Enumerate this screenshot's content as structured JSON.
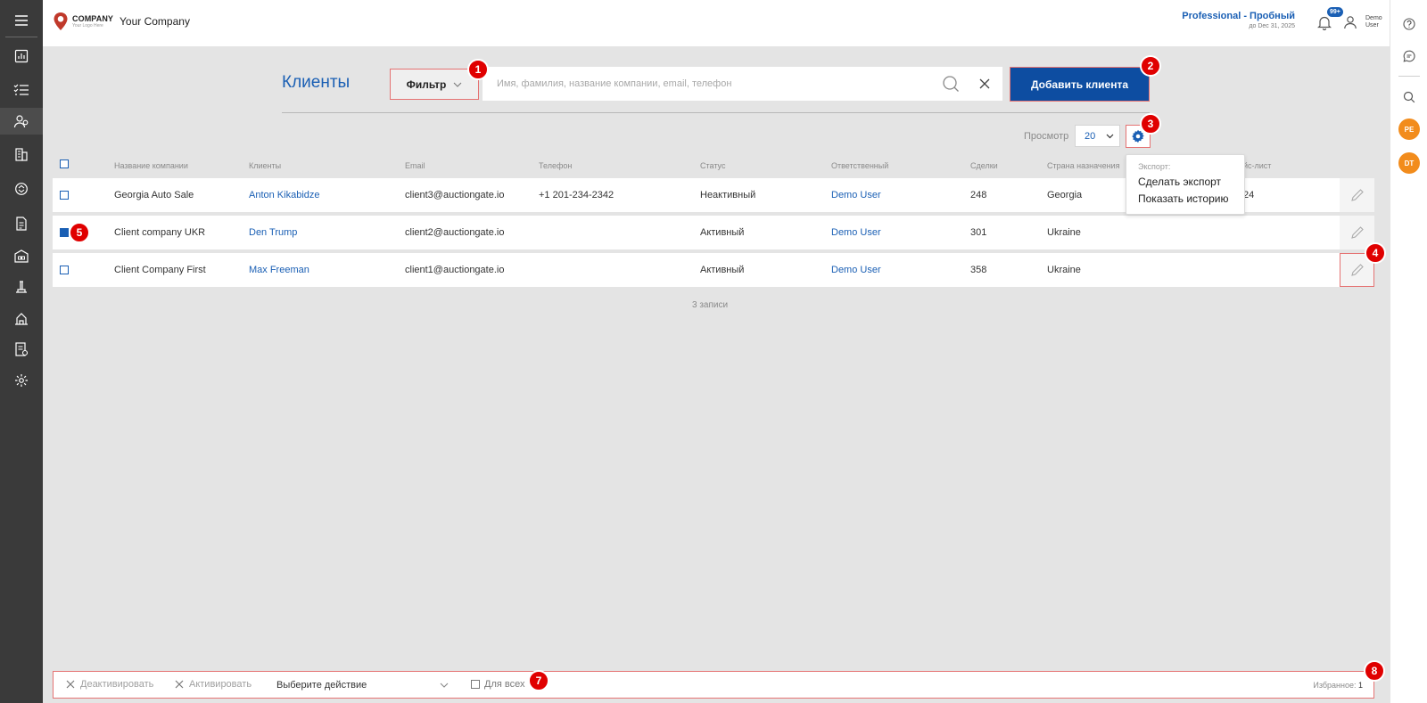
{
  "header": {
    "logo_main": "COMPANY",
    "logo_sub": "Your Logo Here",
    "company_name": "Your Company",
    "plan_title": "Professional - Пробный",
    "plan_date": "до Dec 31, 2025",
    "notifications_badge": "99+",
    "user_name": "Demo User"
  },
  "sidebar": {
    "items": [
      {
        "icon": "menu-icon"
      },
      {
        "icon": "dashboard-icon"
      },
      {
        "icon": "tasks-list-icon"
      },
      {
        "icon": "clients-icon",
        "active": true
      },
      {
        "icon": "buildings-icon"
      },
      {
        "icon": "exchange-icon"
      },
      {
        "icon": "document-icon"
      },
      {
        "icon": "warehouse-icon"
      },
      {
        "icon": "auction-icon"
      },
      {
        "icon": "port-icon"
      },
      {
        "icon": "invoice-icon"
      },
      {
        "icon": "settings-icon"
      }
    ]
  },
  "right_rail": {
    "avatars": [
      "PE",
      "DT"
    ]
  },
  "toolbar": {
    "page_title": "Клиенты",
    "filter_label": "Фильтр",
    "search_placeholder": "Имя, фамилия, название компании, email, телефон",
    "add_client_label": "Добавить клиента",
    "view_label": "Просмотр",
    "page_size": "20"
  },
  "export_menu": {
    "title": "Экспорт:",
    "items": [
      "Сделать экспорт",
      "Показать историю"
    ]
  },
  "table": {
    "columns": [
      "Название компании",
      "Клиенты",
      "Email",
      "Телефон",
      "Статус",
      "Ответственный",
      "Сделки",
      "Страна назначения",
      "йс-лист"
    ],
    "rows": [
      {
        "company": "Georgia Auto Sale",
        "client": "Anton Kikabidze",
        "email": "client3@auctiongate.io",
        "phone": "+1 201-234-2342",
        "status": "Неактивный",
        "manager": "Demo User",
        "deals": "248",
        "country": "Georgia",
        "price_list": "24",
        "checked": false
      },
      {
        "company": "Client company UKR",
        "client": "Den Trump",
        "email": "client2@auctiongate.io",
        "phone": "",
        "status": "Активный",
        "manager": "Demo User",
        "deals": "301",
        "country": "Ukraine",
        "price_list": "",
        "checked": true
      },
      {
        "company": "Client Company First",
        "client": "Max Freeman",
        "email": "client1@auctiongate.io",
        "phone": "",
        "status": "Активный",
        "manager": "Demo User",
        "deals": "358",
        "country": "Ukraine",
        "price_list": "",
        "checked": false
      }
    ],
    "record_count": "3 записи"
  },
  "bottom_bar": {
    "deactivate_label": "Деактивировать",
    "activate_label": "Активировать",
    "action_select": "Выберите действие",
    "for_all_label": "Для всех",
    "favorites_label": "Избранное:",
    "favorites_count": "1"
  },
  "annotations": [
    "1",
    "2",
    "3",
    "4",
    "5",
    "7",
    "8"
  ],
  "colors": {
    "accent": "#1a5fb4",
    "button": "#0d4da1",
    "sidebar": "#3a3a3a",
    "annotation": "#e00000",
    "avatar": "#f28c1c"
  }
}
